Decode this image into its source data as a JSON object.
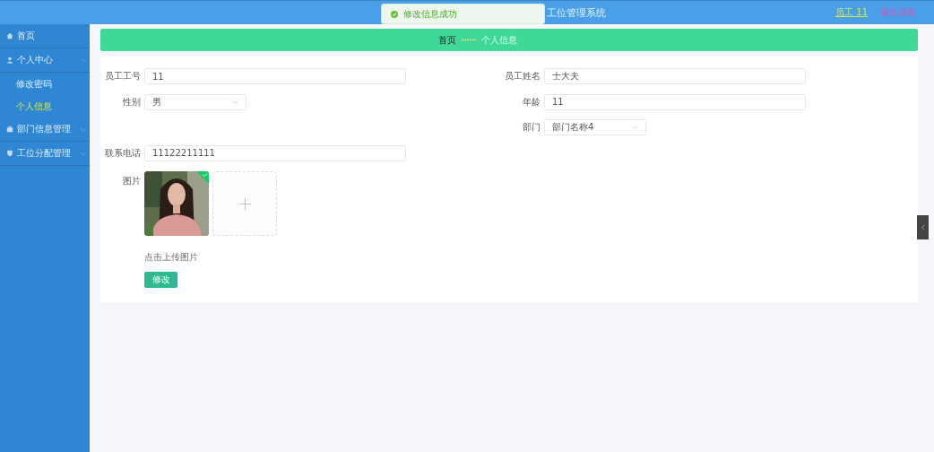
{
  "header": {
    "title": "工位管理系统",
    "user": "员工 11",
    "logout": "退出登录"
  },
  "toast": {
    "kind": "success",
    "message": "修改信息成功"
  },
  "sidebar": {
    "items": [
      {
        "label": "首页",
        "selected": false
      },
      {
        "label": "个人中心",
        "expanded": true,
        "selected": false,
        "children": [
          {
            "label": "修改密码",
            "selected": false
          },
          {
            "label": "个人信息",
            "selected": true
          }
        ]
      },
      {
        "label": "部门信息管理",
        "expanded": false,
        "selected": false
      },
      {
        "label": "工位分配管理",
        "expanded": false,
        "selected": false
      }
    ]
  },
  "breadcrumb": [
    {
      "label": "首页",
      "current": false
    },
    {
      "label": "个人信息",
      "current": true
    }
  ],
  "form": {
    "rows": [
      {
        "left": {
          "kind": "input",
          "label": "员工工号",
          "value": "11"
        },
        "right": {
          "kind": "input",
          "label": "员工姓名",
          "value": "士大夫"
        }
      },
      {
        "left": {
          "kind": "select",
          "label": "性别",
          "value": "男"
        },
        "right": {
          "kind": "input",
          "label": "年龄",
          "value": "11"
        }
      },
      {
        "right": {
          "kind": "select",
          "label": "部门",
          "value": "部门名称4"
        }
      },
      {
        "left": {
          "kind": "input",
          "label": "联系电话",
          "value": "11122211111"
        }
      }
    ],
    "upload": {
      "label": "图片",
      "images": [
        {
          "kind": "picture",
          "uploaded": true
        }
      ],
      "hint": "点击上传图片"
    },
    "submit": "修改"
  }
}
